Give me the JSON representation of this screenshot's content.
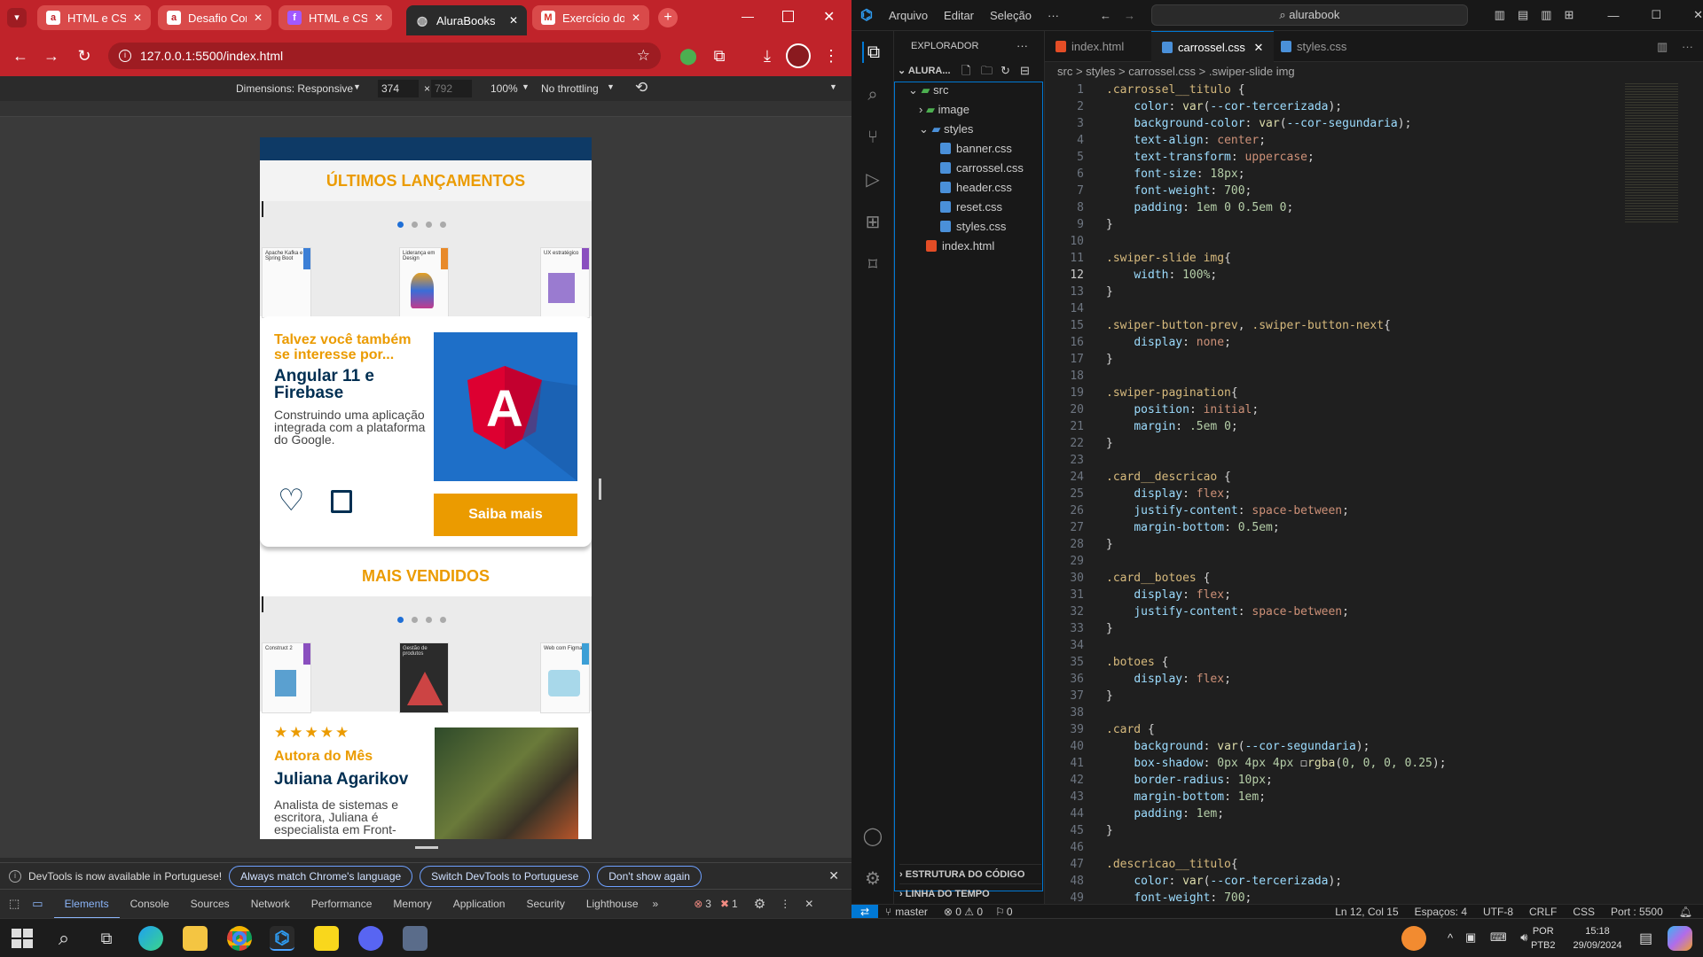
{
  "chrome": {
    "tabs": [
      {
        "title": "HTML e CSS:",
        "favicon": "a"
      },
      {
        "title": "Desafio Conc",
        "favicon": "a"
      },
      {
        "title": "HTML e CSS:",
        "favicon": "f"
      },
      {
        "title": "AluraBooks",
        "favicon": "globe"
      },
      {
        "title": "Exercício do",
        "favicon": "m"
      }
    ],
    "url": "127.0.0.1:5500/index.html",
    "devtools": {
      "dimensions": "Dimensions: Responsive",
      "width": "374",
      "height": "792",
      "zoom": "100%",
      "throttle": "No throttling"
    },
    "notice": {
      "text": "DevTools is now available in Portuguese!",
      "btn1": "Always match Chrome's language",
      "btn2": "Switch DevTools to Portuguese",
      "btn3": "Don't show again"
    },
    "panel_tabs": [
      "Elements",
      "Console",
      "Sources",
      "Network",
      "Performance",
      "Memory",
      "Application",
      "Security",
      "Lighthouse"
    ],
    "errors": "3",
    "warnings": "1"
  },
  "page": {
    "section1_title": "ÚLTIMOS LANÇAMENTOS",
    "books1": [
      "Apache Kafka e Spring Boot",
      "Liderança em Design",
      "UX estratégico"
    ],
    "card": {
      "subtitle": "Talvez você também se interesse por...",
      "title": "Angular 11 e Firebase",
      "desc": "Construindo uma aplicação integrada com a plataforma do Google.",
      "button": "Saiba mais"
    },
    "section2_title": "MAIS VENDIDOS",
    "books2": [
      "Construct 2",
      "Gestão de produtos",
      "Web com Figma"
    ],
    "author": {
      "stars": "★★★★★",
      "label": "Autora do Mês",
      "name": "Juliana Agarikov",
      "desc": "Analista de sistemas e escritora, Juliana é especialista em Front-"
    }
  },
  "vscode": {
    "menu": [
      "Arquivo",
      "Editar",
      "Seleção",
      "···"
    ],
    "search": "alurabook",
    "explorer_title": "EXPLORADOR",
    "workspace": "ALURA...",
    "tree": [
      "src",
      "image",
      "styles",
      "banner.css",
      "carrossel.css",
      "header.css",
      "reset.css",
      "styles.css",
      "index.html"
    ],
    "outline": "ESTRUTURA DO CÓDIGO",
    "timeline": "LINHA DO TEMPO",
    "editor_tabs": [
      "index.html",
      "carrossel.css",
      "styles.css"
    ],
    "breadcrumb": "src > styles > carrossel.css > .swiper-slide img",
    "status": {
      "branch": "master",
      "problems": "⊗ 0 ⚠ 0",
      "ports": "0",
      "position": "Ln 12, Col 15",
      "spaces": "Espaços: 4",
      "encoding": "UTF-8",
      "eol": "CRLF",
      "lang": "CSS",
      "port": "Port : 5500"
    }
  },
  "taskbar": {
    "lang1": "POR",
    "lang2": "PTB2",
    "time": "15:18",
    "date": "29/09/2024"
  },
  "colors": {
    "accent": "#eb9b00",
    "chrome_red": "#c0232a",
    "vscode_blue": "#0078d4"
  }
}
